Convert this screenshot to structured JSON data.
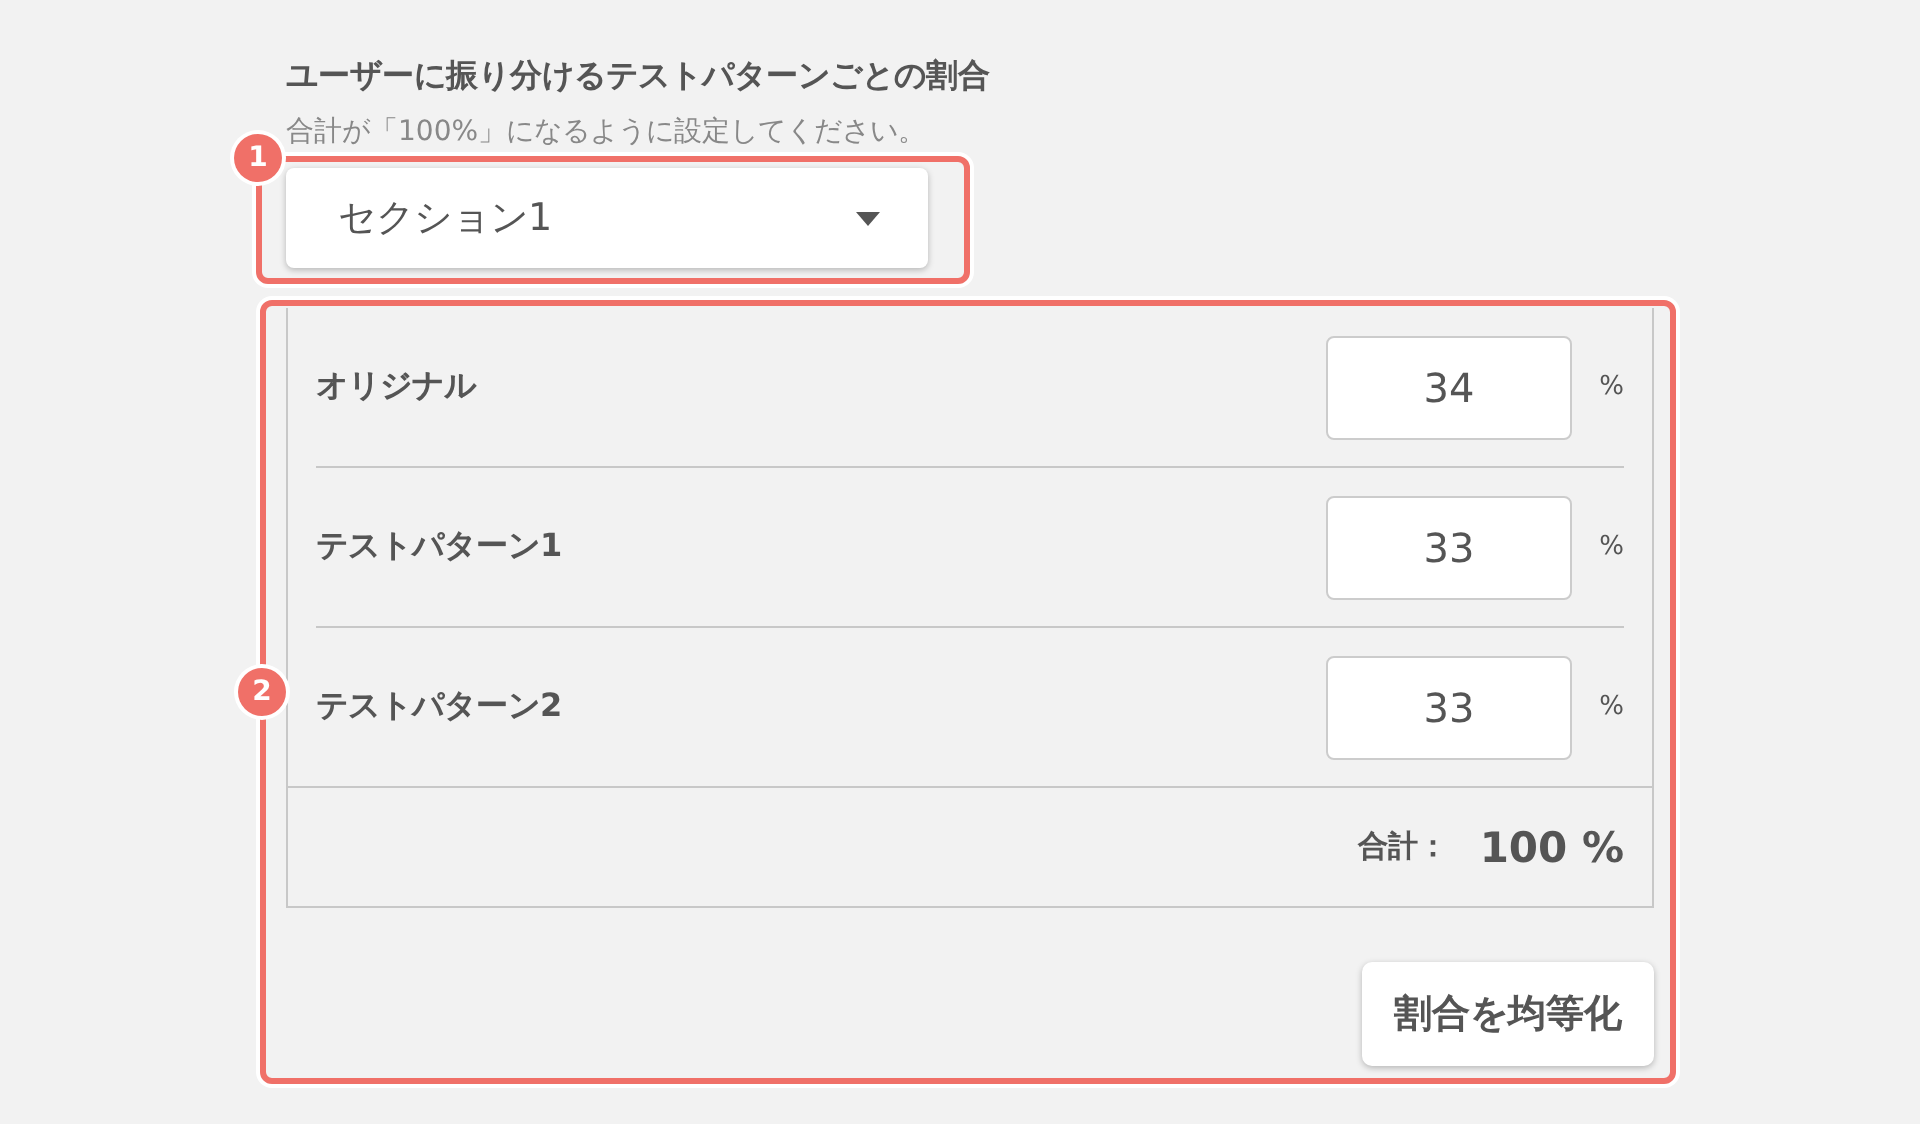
{
  "heading": "ユーザーに振り分けるテストパターンごとの割合",
  "note": "合計が「100%」になるように設定してください。",
  "section_select": {
    "marker": "1",
    "value": "セクション1"
  },
  "ratio_panel": {
    "marker": "2",
    "rows": [
      {
        "label": "オリジナル",
        "value": "34",
        "unit": "%"
      },
      {
        "label": "テストパターン1",
        "value": "33",
        "unit": "%"
      },
      {
        "label": "テストパターン2",
        "value": "33",
        "unit": "%"
      }
    ],
    "total_label": "合計：",
    "total_value": "100 %",
    "equalize_button": "割合を均等化"
  }
}
